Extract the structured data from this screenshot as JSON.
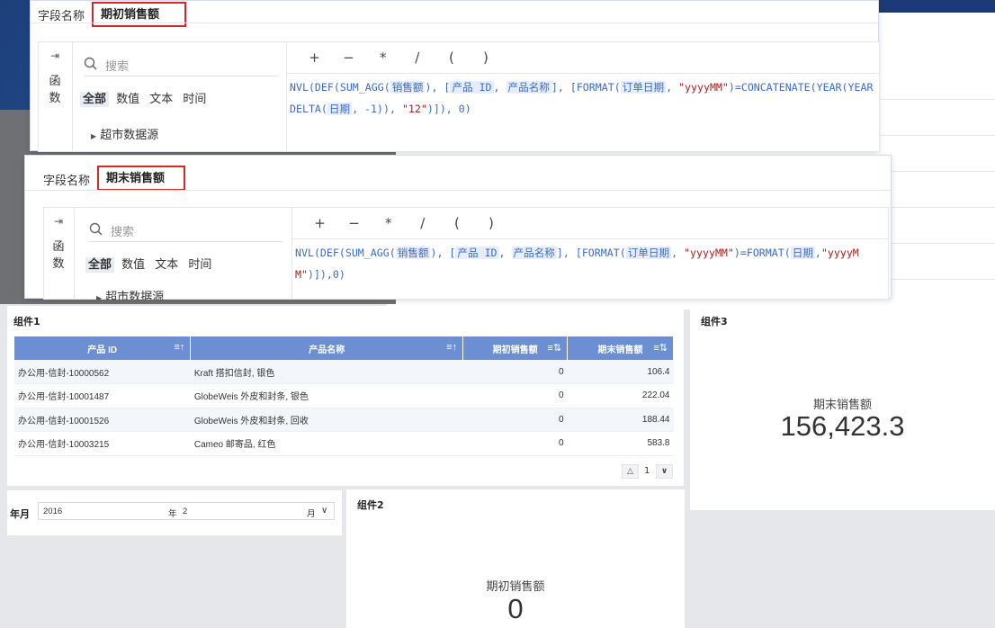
{
  "dialog_top": {
    "field_label": "字段名称",
    "field_value": "期初销售额",
    "side_label_1": "函",
    "side_label_2": "数",
    "search_placeholder": "搜索",
    "categories": [
      "全部",
      "数值",
      "文本",
      "时间"
    ],
    "tree_item": "超市数据源",
    "operators": [
      "+",
      "−",
      "*",
      "/",
      "(",
      ")"
    ],
    "formula": {
      "p1": "NVL(DEF(SUM_AGG(",
      "f1": "销售额",
      "p2": "), [",
      "f2": "产品 ID",
      "p3": ", ",
      "f3": "产品名称",
      "p4": "], [FORMAT(",
      "f4": "订单日期",
      "p5": ", ",
      "s1": "\"yyyyMM\"",
      "p6": ")=CONCATENATE(YEAR(YEARDELTA(",
      "f5": "日期",
      "p7": ", -1)), ",
      "s2": "\"12\"",
      "p8": ")]), 0)"
    }
  },
  "dialog_bottom": {
    "field_label": "字段名称",
    "field_value": "期末销售额",
    "side_label_1": "函",
    "side_label_2": "数",
    "search_placeholder": "搜索",
    "categories": [
      "全部",
      "数值",
      "文本",
      "时间"
    ],
    "tree_item": "超市数据源",
    "operators": [
      "+",
      "−",
      "*",
      "/",
      "(",
      ")"
    ],
    "formula": {
      "p1": "NVL(DEF(SUM_AGG(",
      "f1": "销售额",
      "p2": "), [",
      "f2": "产品 ID",
      "p3": ", ",
      "f3": "产品名称",
      "p4": "], [FORMAT(",
      "f4": "订单日期",
      "p5": ", ",
      "s1": "\"yyyyMM\"",
      "p6": ")=FORMAT(",
      "f5": "日期",
      "p7": ",",
      "s2": "\"yyyyMM\"",
      "p8": ")]),0)"
    }
  },
  "component1": {
    "title": "组件1",
    "columns": [
      "产品 ID",
      "产品名称",
      "期初销售额",
      "期末销售额"
    ],
    "rows": [
      [
        "办公用-信封-10000562",
        "Kraft 搭扣信封, 银色",
        "0",
        "106.4"
      ],
      [
        "办公用-信封-10001487",
        "GlobeWeis 外皮和封条, 银色",
        "0",
        "222.04"
      ],
      [
        "办公用-信封-10001526",
        "GlobeWeis 外皮和封条, 回收",
        "0",
        "188.44"
      ],
      [
        "办公用-信封-10003215",
        "Cameo 邮寄品, 红色",
        "0",
        "583.8"
      ]
    ],
    "page": "1"
  },
  "component2": {
    "title": "组件2",
    "label": "期初销售额",
    "value": "0"
  },
  "component3": {
    "title": "组件3",
    "label": "期末销售额",
    "value": "156,423.3"
  },
  "year_month": {
    "label": "年月",
    "year": "2016",
    "year_unit": "年",
    "month": "2",
    "month_unit": "月"
  }
}
